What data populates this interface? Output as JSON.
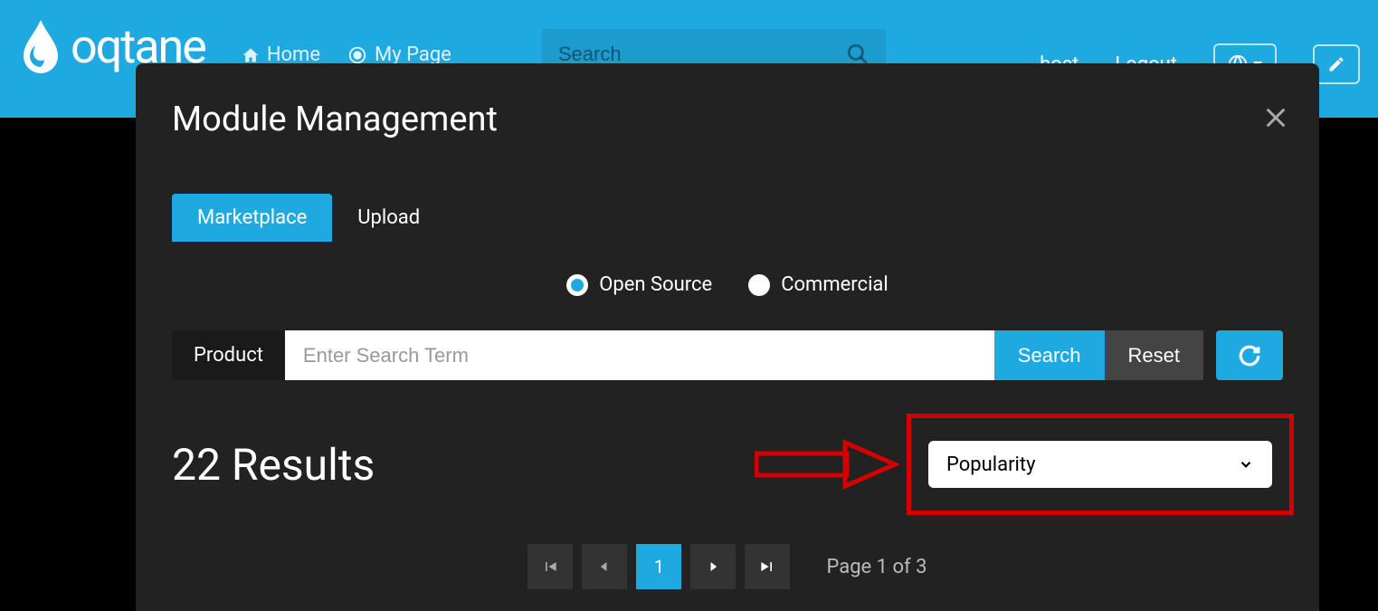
{
  "nav": {
    "brand": "oqtane",
    "home": "Home",
    "myPage": "My Page",
    "searchPlaceholder": "Search",
    "user": "host",
    "logout": "Logout"
  },
  "modal": {
    "title": "Module Management",
    "tabs": {
      "marketplace": "Marketplace",
      "upload": "Upload"
    },
    "source": {
      "open": "Open Source",
      "commercial": "Commercial"
    },
    "searchRow": {
      "label": "Product",
      "placeholder": "Enter Search Term",
      "searchBtn": "Search",
      "resetBtn": "Reset"
    },
    "results": {
      "count": "22 Results",
      "sort": "Popularity"
    },
    "pagination": {
      "current": "1",
      "info": "Page 1 of 3"
    }
  }
}
